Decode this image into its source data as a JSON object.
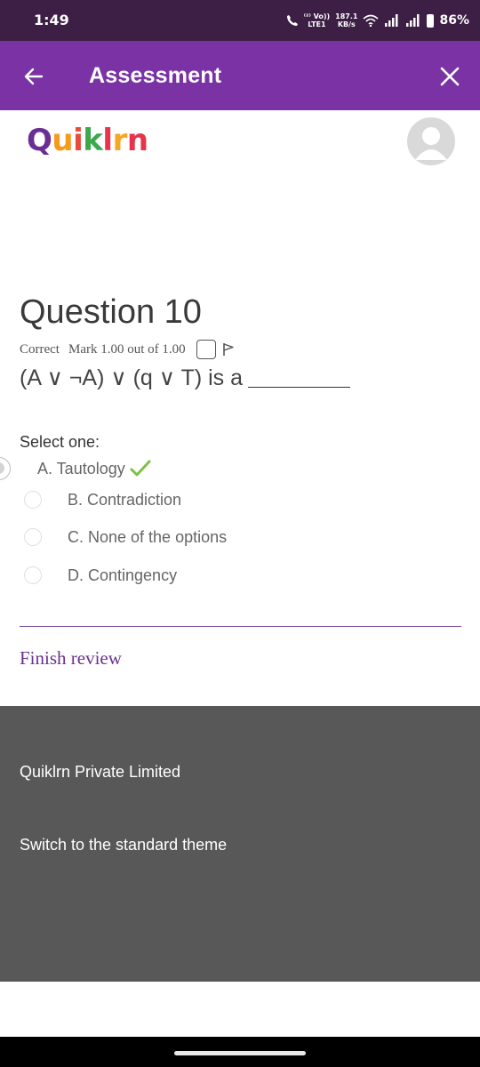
{
  "status_bar": {
    "time": "1:49",
    "network_top": "⁽²⁾ Vo))",
    "network_bottom": "LTE1",
    "speed_value": "187.1",
    "speed_unit": "KB/s",
    "battery": "86%"
  },
  "app_bar": {
    "title": "Assessment",
    "back_icon": "arrow-left-icon",
    "close_icon": "close-icon",
    "background": "#7a32a5"
  },
  "logo": {
    "letters": [
      "Q",
      "u",
      "i",
      "k",
      "l",
      "r",
      "n"
    ],
    "colors": [
      "#6b2f93",
      "#f59a1b",
      "#e84a3c",
      "#3ba84a",
      "#e8334a",
      "#f5a623",
      "#e8334a"
    ]
  },
  "question": {
    "title": "Question 10",
    "state": "Correct",
    "mark": "Mark 1.00 out of 1.00",
    "text": "(A ∨ ¬A) ∨ (q ∨ T) is a",
    "select_label": "Select one:",
    "selected_answer": "A. Tautology",
    "options": [
      "B. Contradiction",
      "C. None of the options",
      "D. Contingency"
    ]
  },
  "finish_review": "Finish review",
  "footer": {
    "company": "Quiklrn Private Limited",
    "switch_theme": "Switch to the standard theme"
  },
  "colors": {
    "status_bar": "#3d1e44",
    "accent": "#7a32a5",
    "link": "#6a3190",
    "footer": "#585858",
    "check": "#7cc142"
  }
}
